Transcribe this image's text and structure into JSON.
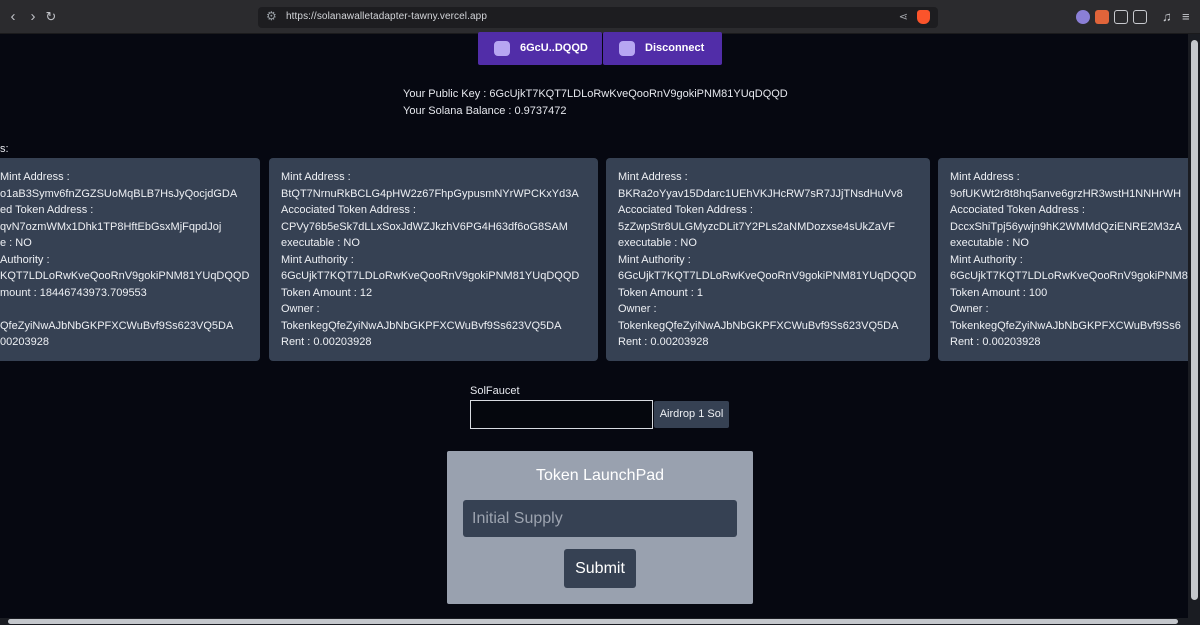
{
  "browser": {
    "url": "https://solanawalletadapter-tawny.vercel.app"
  },
  "wallet": {
    "address_button_label": "6GcU..DQQD",
    "disconnect_button_label": "Disconnect"
  },
  "account": {
    "public_key_line": "Your Public Key : 6GcUjkT7KQT7LDLoRwKveQooRnV9gokiPNM81YUqDQQD",
    "balance_line": "Your Solana Balance : 0.9737472"
  },
  "tokens_label": "s:",
  "cards": [
    {
      "lines": [
        "Mint Address :",
        "o1aB3Symv6fnZGZSUoMqBLB7HsJyQocjdGDA",
        "ed Token Address :",
        "qvN7ozmWMx1Dhk1TP8HftEbGsxMjFqpdJoj",
        "e : NO",
        "Authority :",
        "KQT7LDLoRwKveQooRnV9gokiPNM81YUqDQQD",
        "mount : 18446743973.709553",
        "",
        "QfeZyiNwAJbNbGKPFXCWuBvf9Ss623VQ5DA",
        "00203928"
      ]
    },
    {
      "lines": [
        "Mint Address :",
        "BtQT7NrnuRkBCLG4pHW2z67FhpGypusmNYrWPCKxYd3A",
        "Accociated Token Address :",
        "CPVy76b5eSk7dLLxSoxJdWZJkzhV6PG4H63df6oG8SAM",
        "executable : NO",
        "Mint Authority :",
        "6GcUjkT7KQT7LDLoRwKveQooRnV9gokiPNM81YUqDQQD",
        "Token Amount : 12",
        "Owner :",
        "TokenkegQfeZyiNwAJbNbGKPFXCWuBvf9Ss623VQ5DA",
        "Rent : 0.00203928"
      ]
    },
    {
      "lines": [
        "Mint Address :",
        "BKRa2oYyav15Ddarc1UEhVKJHcRW7sR7JJjTNsdHuVv8",
        "Accociated Token Address :",
        "5zZwpStr8ULGMyzcDLit7Y2PLs2aNMDozxse4sUkZaVF",
        "executable : NO",
        "Mint Authority :",
        "6GcUjkT7KQT7LDLoRwKveQooRnV9gokiPNM81YUqDQQD",
        "Token Amount : 1",
        "Owner :",
        "TokenkegQfeZyiNwAJbNbGKPFXCWuBvf9Ss623VQ5DA",
        "Rent : 0.00203928"
      ]
    },
    {
      "lines": [
        "Mint Address :",
        "9ofUKWt2r8t8hq5anve6grzHR3wstH1NNHrWH",
        "Accociated Token Address :",
        "DccxShiTpj56ywjn9hK2WMMdQziENRE2M3zA",
        "executable : NO",
        "Mint Authority :",
        "6GcUjkT7KQT7LDLoRwKveQooRnV9gokiPNM8",
        "Token Amount : 100",
        "Owner :",
        "TokenkegQfeZyiNwAJbNbGKPFXCWuBvf9Ss6",
        "Rent : 0.00203928"
      ]
    }
  ],
  "faucet": {
    "label": "SolFaucet",
    "input_value": "",
    "airdrop_label": "Airdrop 1 Sol"
  },
  "launchpad": {
    "title": "Token LaunchPad",
    "supply_placeholder": "Initial Supply",
    "submit_label": "Submit"
  },
  "icons": {
    "back": "back-arrow-icon",
    "forward": "forward-arrow-icon",
    "reload": "reload-icon",
    "site_settings": "site-settings-icon",
    "share": "share-icon",
    "brave": "brave-shield-icon",
    "wallet": "wallet-icon"
  },
  "colors": {
    "background": "#060811",
    "wallet_button": "#512da8",
    "card": "#364153",
    "launchpad": "#99a1af"
  }
}
